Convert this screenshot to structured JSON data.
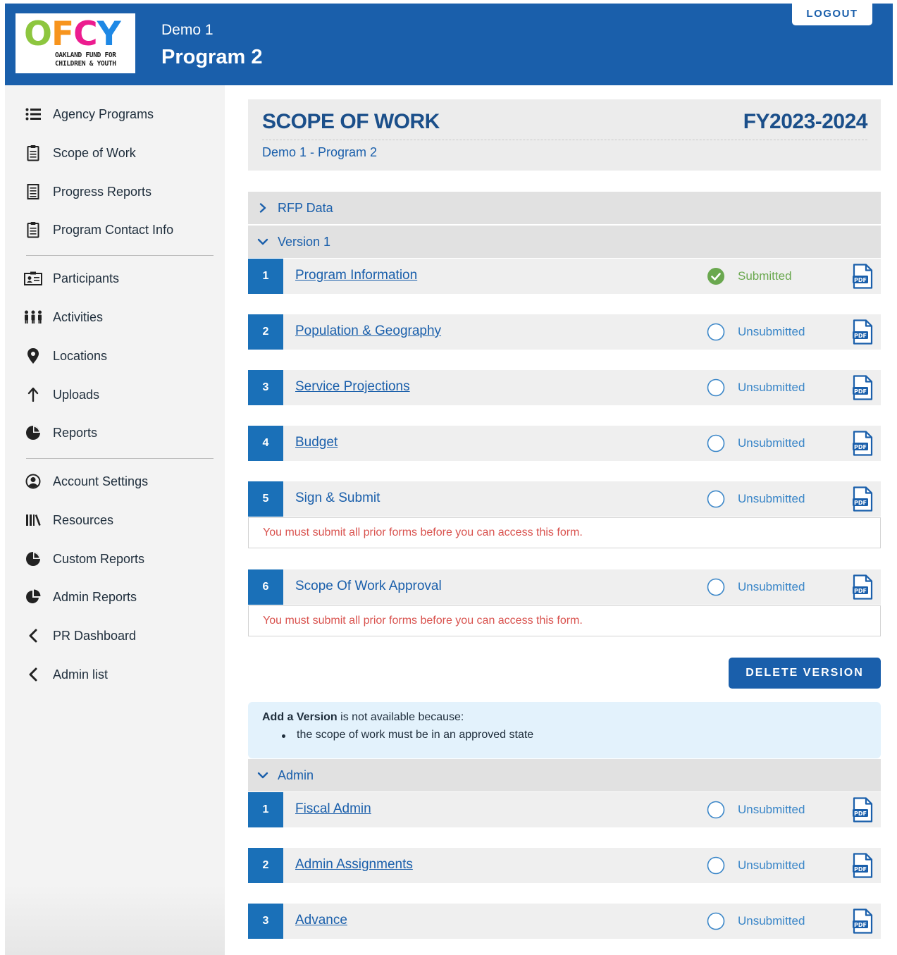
{
  "header": {
    "logo_letters": [
      "O",
      "F",
      "C",
      "Y"
    ],
    "logo_colors": [
      "#8dc63f",
      "#f7941d",
      "#ec1c8f",
      "#1e88e5"
    ],
    "logo_subtitle_line1": "OAKLAND FUND FOR",
    "logo_subtitle_line2": "CHILDREN & YOUTH",
    "org_name": "Demo 1",
    "program_name": "Program 2",
    "logout_label": "LOGOUT"
  },
  "sidebar": {
    "items": [
      {
        "label": "Agency Programs",
        "icon": "list-icon"
      },
      {
        "label": "Scope of Work",
        "icon": "clipboard-icon"
      },
      {
        "label": "Progress Reports",
        "icon": "document-icon"
      },
      {
        "label": "Program Contact Info",
        "icon": "clipboard-icon"
      },
      {
        "label": "Participants",
        "icon": "id-card-icon"
      },
      {
        "label": "Activities",
        "icon": "people-icon"
      },
      {
        "label": "Locations",
        "icon": "map-pin-icon"
      },
      {
        "label": "Uploads",
        "icon": "arrow-up-icon"
      },
      {
        "label": "Reports",
        "icon": "pie-chart-icon"
      },
      {
        "label": "Account Settings",
        "icon": "user-circle-icon"
      },
      {
        "label": "Resources",
        "icon": "books-icon"
      },
      {
        "label": "Custom Reports",
        "icon": "pie-chart-icon"
      },
      {
        "label": "Admin Reports",
        "icon": "pie-chart-icon"
      },
      {
        "label": "PR Dashboard",
        "icon": "chevron-left-icon"
      },
      {
        "label": "Admin list",
        "icon": "chevron-left-icon"
      }
    ]
  },
  "main": {
    "title": "SCOPE OF WORK",
    "fiscal_year": "FY2023-2024",
    "subtitle": "Demo 1 - Program 2",
    "rfp_label": "RFP Data",
    "version_label": "Version 1",
    "version_rows": [
      {
        "num": "1",
        "label": "Program Information",
        "status": "Submitted"
      },
      {
        "num": "2",
        "label": "Population & Geography",
        "status": "Unsubmitted"
      },
      {
        "num": "3",
        "label": "Service Projections",
        "status": "Unsubmitted"
      },
      {
        "num": "4",
        "label": "Budget",
        "status": "Unsubmitted"
      },
      {
        "num": "5",
        "label": "Sign & Submit",
        "status": "Unsubmitted",
        "warning": "You must submit all prior forms before you can access this form."
      },
      {
        "num": "6",
        "label": "Scope Of Work Approval",
        "status": "Unsubmitted",
        "warning": "You must submit all prior forms before you can access this form."
      }
    ],
    "delete_label": "DELETE VERSION",
    "info": {
      "bold": "Add a Version",
      "rest": " is not available because:",
      "reason": "the scope of work must be in an approved state"
    },
    "admin_label": "Admin",
    "admin_rows": [
      {
        "num": "1",
        "label": "Fiscal Admin",
        "status": "Unsubmitted"
      },
      {
        "num": "2",
        "label": "Admin Assignments",
        "status": "Unsubmitted"
      },
      {
        "num": "3",
        "label": "Advance",
        "status": "Unsubmitted"
      }
    ],
    "pdf_label": "PDF"
  },
  "colors": {
    "brand_blue": "#1a5fab",
    "row_number_blue": "#1a70b8",
    "submitted_green": "#6aa84f",
    "unsubmitted_blue": "#3a86c8",
    "warning_red": "#d9534f"
  }
}
